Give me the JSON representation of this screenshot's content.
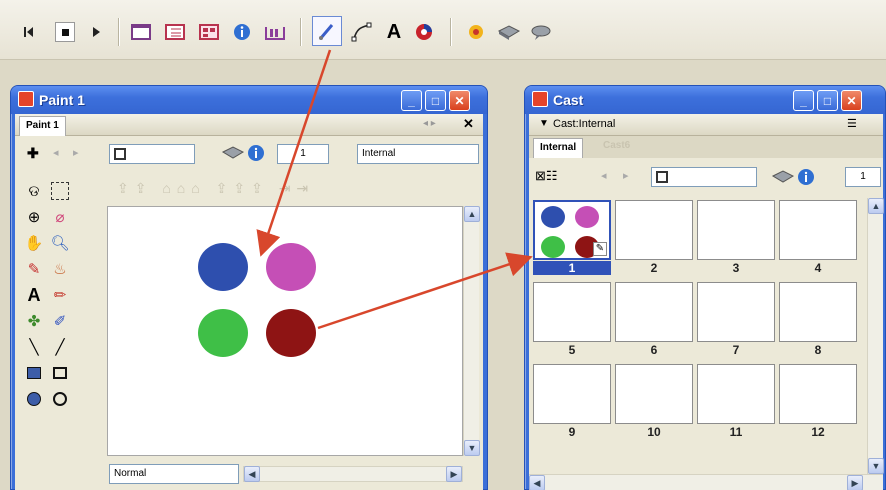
{
  "toolbar": {
    "icons": [
      "rewind-icon",
      "stop-icon",
      "play-icon",
      "stage-icon",
      "score-icon",
      "cast-icon",
      "property-inspector-icon",
      "library-icon",
      "paint-brush-icon",
      "vector-shape-icon",
      "text-icon",
      "color-icon",
      "behavior-icon",
      "script-icon",
      "message-icon"
    ]
  },
  "paint_window": {
    "title": "Paint 1",
    "tab_label": "Paint 1",
    "cast_field_value": "1",
    "cast_library": "Internal",
    "ink_mode": "Normal",
    "circle_colors": [
      "#2e4fae",
      "#c54fb6",
      "#3fbf47",
      "#8e1414"
    ]
  },
  "cast_window": {
    "title": "Cast",
    "panel_label": "Cast:Internal",
    "tabs": [
      "Internal",
      "Cast6"
    ],
    "cast_field_value": "1",
    "members": [
      "1",
      "2",
      "3",
      "4",
      "5",
      "6",
      "7",
      "8",
      "9",
      "10",
      "11",
      "12"
    ],
    "selected_member": "1"
  },
  "colors": {
    "arrow": "#d8472c",
    "selection": "#3052b8"
  }
}
